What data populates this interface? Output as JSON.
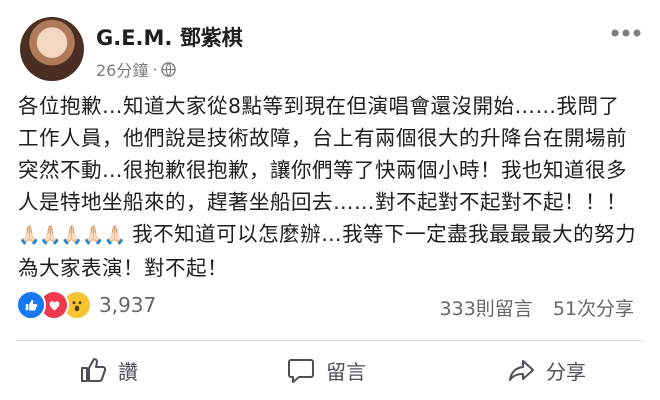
{
  "post": {
    "author": "G.E.M. 鄧紫棋",
    "timestamp": "26分鐘",
    "separator": "·",
    "text_part1": "各位抱歉…知道大家從8點等到現在但演唱會還沒開始……我問了工作人員，他們說是技術故障，台上有兩個很大的升降台在開場前突然不動…很抱歉很抱歉，讓你們等了快兩個小時！我也知道很多人是特地坐船來的，趕著坐船回去……對不起對不起對不起！！！",
    "emoji": "🙏🏻🙏🏻🙏🏻🙏🏻🙏🏻",
    "text_part2": " 我不知道可以怎麼辦…我等下一定盡我最最最大的努力為大家表演！對不起！"
  },
  "reactions": {
    "count": "3,937",
    "comments": "333則留言",
    "shares": "51次分享"
  },
  "actions": {
    "like": "讚",
    "comment": "留言",
    "share": "分享"
  },
  "colors": {
    "like_blue": "#1877f2",
    "love_red": "#f0384f",
    "wow_yellow": "#f7c533"
  }
}
